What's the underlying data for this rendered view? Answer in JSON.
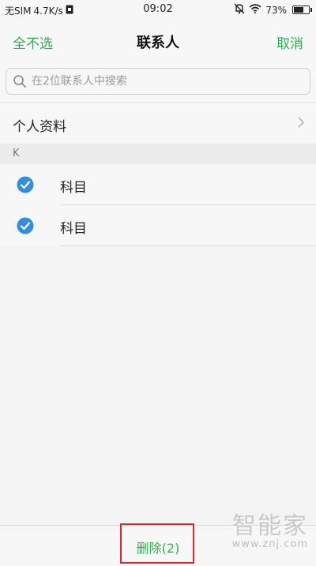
{
  "status_bar": {
    "carrier": "无SIM",
    "speed": "4.7K/s",
    "time": "09:02",
    "battery_percent": "73%",
    "battery_level": 0.73,
    "icons": [
      "sim-lock-icon",
      "mute-bell-icon",
      "wifi-icon",
      "battery-icon"
    ]
  },
  "nav": {
    "left_action": "全不选",
    "title": "联系人",
    "right_action": "取消",
    "accent_color": "#2bb24c"
  },
  "search": {
    "placeholder": "在2位联系人中搜索",
    "value": ""
  },
  "profile": {
    "label": "个人资料"
  },
  "sections": [
    {
      "letter": "K",
      "contacts": [
        {
          "name": "科目",
          "checked": true
        },
        {
          "name": "科目",
          "checked": true
        }
      ]
    }
  ],
  "bottom": {
    "delete_label": "删除(2)"
  },
  "watermark": {
    "logo": "智能家",
    "url": "www.znj.com"
  },
  "colors": {
    "check_blue": "#2f8fe0",
    "highlight_red": "#d9282c"
  }
}
